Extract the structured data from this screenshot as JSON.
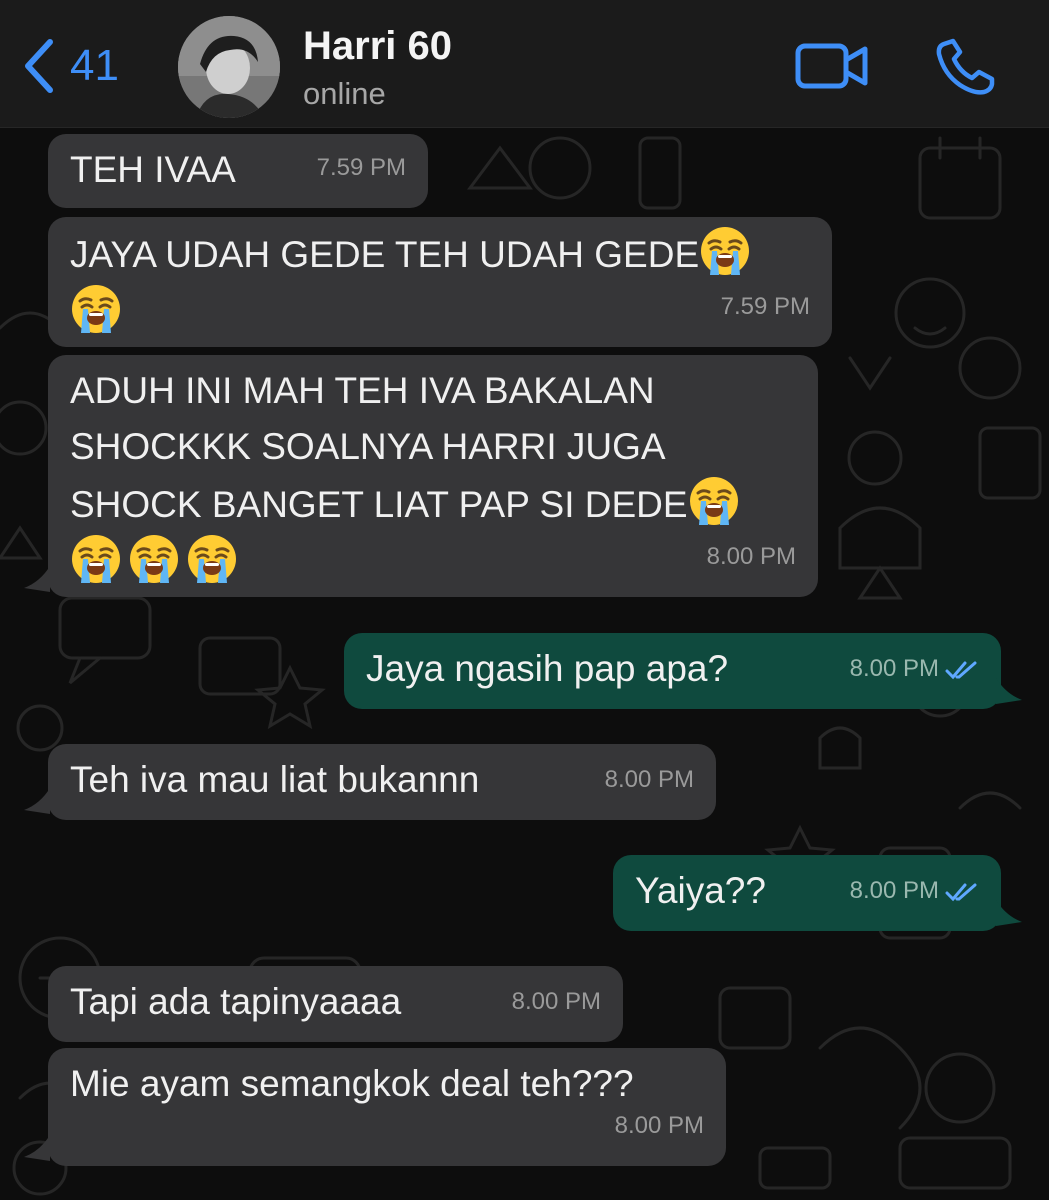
{
  "header": {
    "back_count": "41",
    "contact_name": "Harri 60",
    "status": "online"
  },
  "colors": {
    "accent": "#3e8ef7",
    "incoming_bubble": "#363638",
    "outgoing_bubble": "#0f4a3e",
    "read_ticks": "#5fa8ff"
  },
  "messages": [
    {
      "direction": "in",
      "text": "TEH IVAA",
      "time": "7.59 PM"
    },
    {
      "direction": "in",
      "text_line1": "JAYA UDAH GEDE TEH UDAH GEDE",
      "emoji": "loudly-crying-face",
      "time": "7.59 PM"
    },
    {
      "direction": "in",
      "text_line1": "ADUH INI MAH TEH IVA BAKALAN",
      "text_line2": "SHOCKKK SOALNYA HARRI JUGA",
      "text_line3": "SHOCK BANGET LIAT PAP SI DEDE",
      "emoji": "loudly-crying-face",
      "time": "8.00 PM"
    },
    {
      "direction": "out",
      "text": "Jaya ngasih pap apa?",
      "time": "8.00 PM",
      "status": "read"
    },
    {
      "direction": "in",
      "text": "Teh iva mau liat bukannn",
      "time": "8.00 PM"
    },
    {
      "direction": "out",
      "text": "Yaiya??",
      "time": "8.00 PM",
      "status": "read"
    },
    {
      "direction": "in",
      "text": "Tapi ada tapinyaaaa",
      "time": "8.00 PM"
    },
    {
      "direction": "in",
      "text": "Mie ayam semangkok deal teh???",
      "time": "8.00 PM"
    }
  ]
}
